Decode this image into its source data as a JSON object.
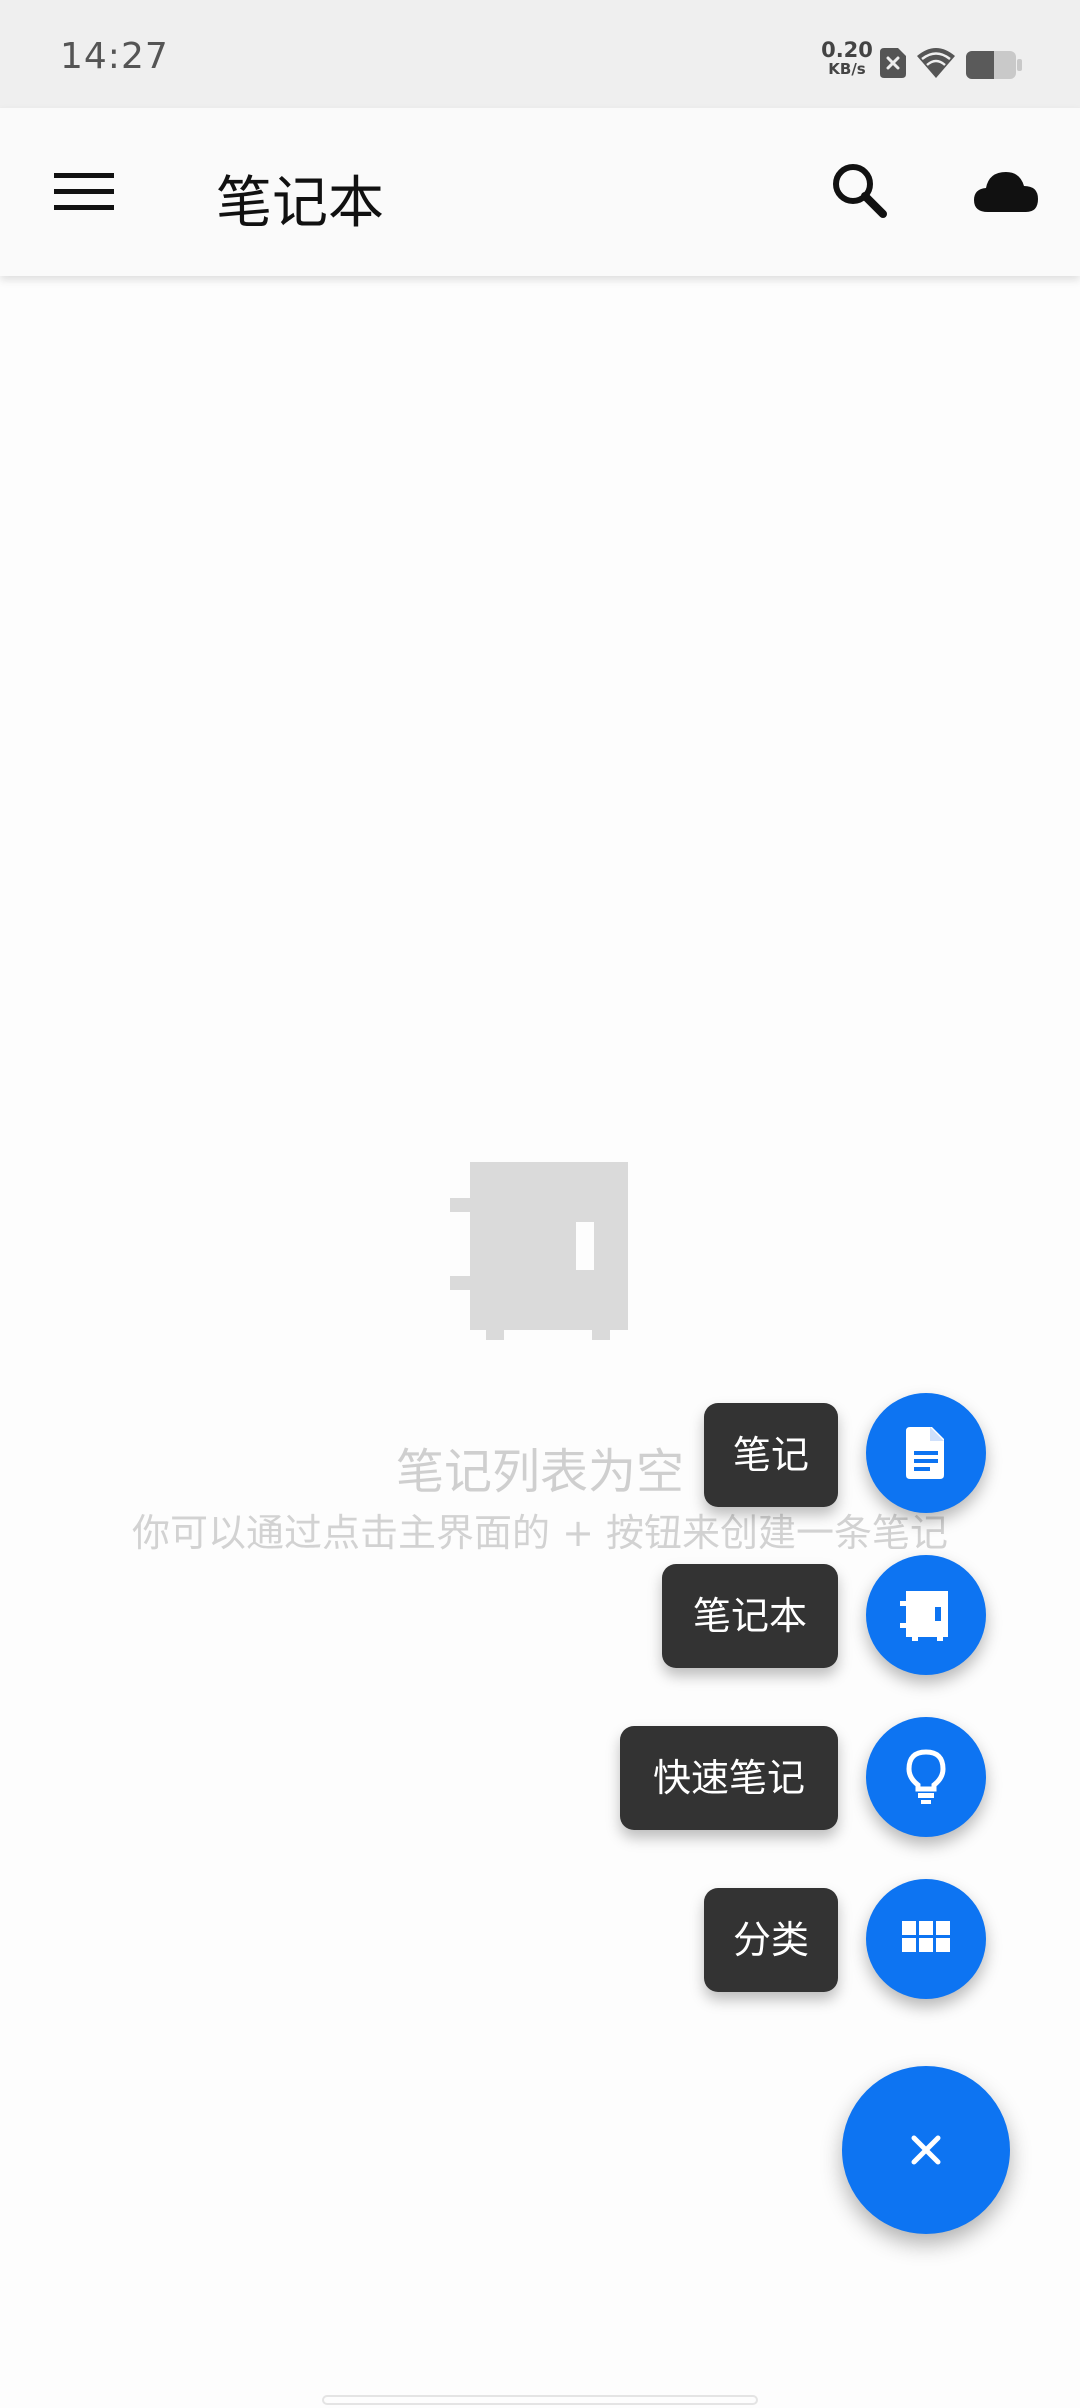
{
  "status_bar": {
    "time": "14:27",
    "net_speed_value": "0.20",
    "net_speed_unit": "KB/s",
    "icons": [
      "sim-error-icon",
      "wifi-icon",
      "battery-icon"
    ]
  },
  "app_bar": {
    "title": "笔记本",
    "icons": [
      "menu-icon",
      "search-icon",
      "cloud-sync-icon"
    ]
  },
  "empty_state": {
    "icon": "notebook-icon",
    "title": "笔记列表为空",
    "description": "你可以通过点击主界面的 + 按钮来创建一条笔记"
  },
  "speed_dial": {
    "items": [
      {
        "label": "笔记",
        "icon": "note-document-icon"
      },
      {
        "label": "笔记本",
        "icon": "notebook-icon"
      },
      {
        "label": "快速笔记",
        "icon": "lightbulb-icon"
      },
      {
        "label": "分类",
        "icon": "grid-icon"
      }
    ],
    "close_icon": "close-icon"
  },
  "colors": {
    "accent": "#0d74f2",
    "label_background": "#333333",
    "empty_text": "#cfcfcf"
  }
}
